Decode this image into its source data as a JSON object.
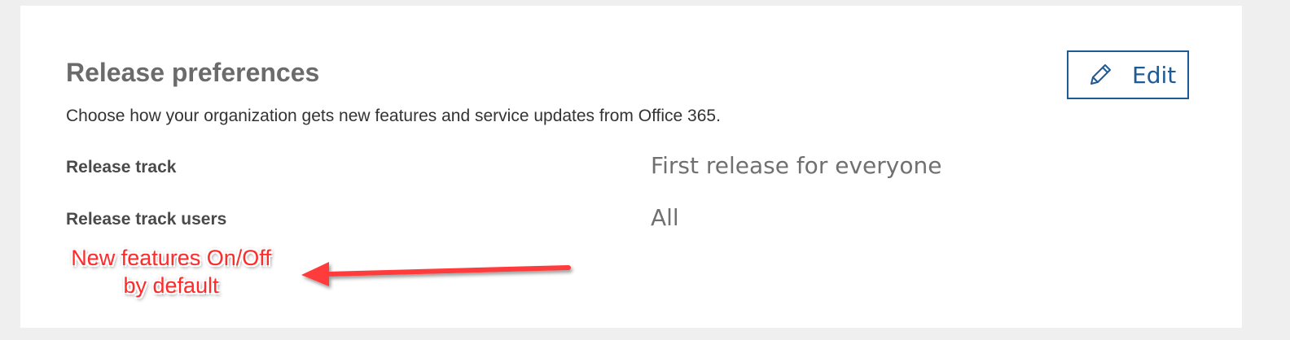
{
  "section": {
    "title": "Release preferences",
    "description": "Choose how your organization gets new features and service updates from Office 365.",
    "edit_label": "Edit",
    "edit_icon": "pencil-icon",
    "rows": [
      {
        "label": "Release track",
        "value": "First release for everyone"
      },
      {
        "label": "Release track users",
        "value": "All"
      }
    ]
  },
  "annotation": {
    "line1": "New features On/Off",
    "line2": "by default",
    "color": "#ff2a2a"
  },
  "colors": {
    "accent": "#1e5a96",
    "background": "#efefef",
    "card": "#ffffff"
  }
}
